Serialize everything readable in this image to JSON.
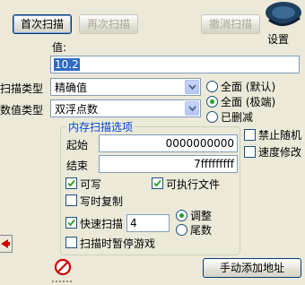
{
  "toolbar": {
    "first_scan": "首次扫描",
    "next_scan": "再次扫描",
    "undo_scan": "撤消扫描",
    "settings": "设置"
  },
  "value": {
    "label": "值:",
    "input": "10.2"
  },
  "scan_type": {
    "label": "扫描类型",
    "selected": "精确值"
  },
  "value_type": {
    "label": "数值类型",
    "selected": "双浮点数"
  },
  "range_options": {
    "full_default": "全面 (默认)",
    "full_extreme": "全面 (极端)",
    "deleted": "已删减",
    "selected": "full_extreme"
  },
  "memory_options": {
    "title": "内存扫描选项",
    "start_label": "起始",
    "start_value": "0000000000",
    "end_label": "结束",
    "end_value": "7fffffffff",
    "writable": "可写",
    "executable": "可执行文件",
    "copy_on_write": "写时复制",
    "fast_scan": "快速扫描",
    "fast_scan_value": "4",
    "align": "调整",
    "last_digits": "尾数",
    "pause_game": "扫描时暂停游戏",
    "writable_checked": true,
    "executable_checked": true,
    "copy_on_write_checked": false,
    "fast_scan_checked": true,
    "pause_game_checked": false,
    "align_selected": true
  },
  "side_options": {
    "disable_random": "禁止随机",
    "speed_modify": "速度修改"
  },
  "bottom": {
    "add_address": "手动添加地址"
  },
  "colors": {
    "accent": "#316ac5",
    "group_title": "#0046d5",
    "stop_icon": "#cc0000"
  }
}
